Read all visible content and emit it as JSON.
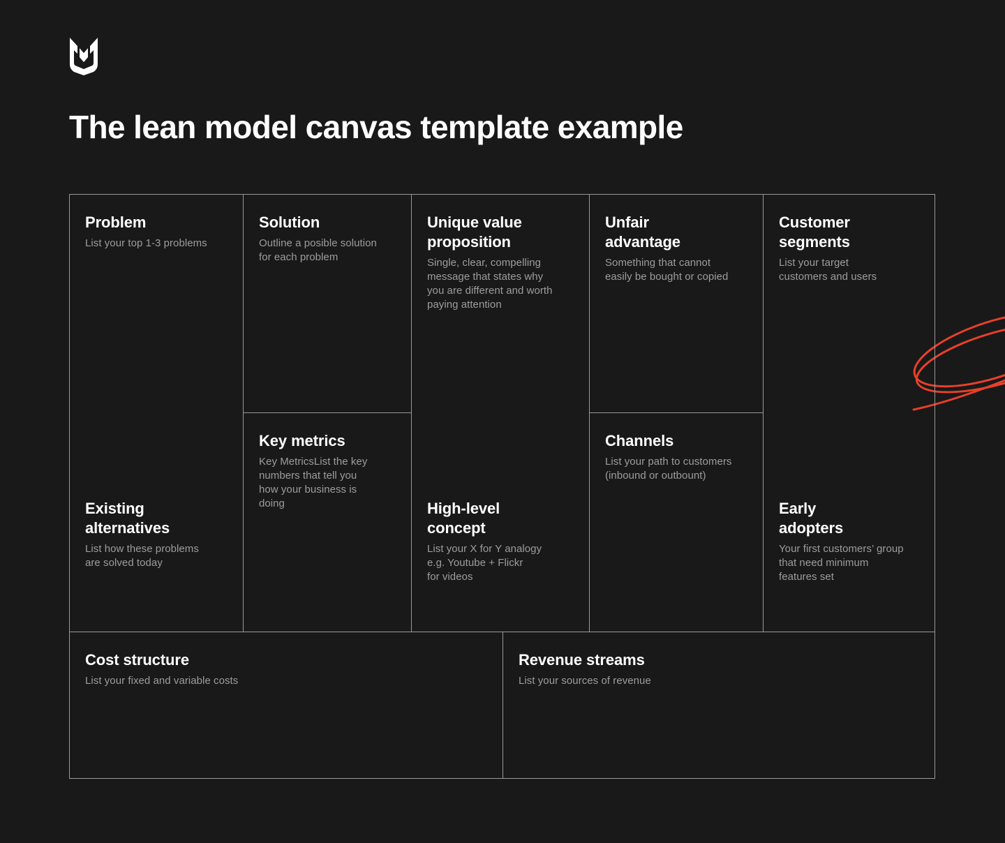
{
  "brand": {
    "logo_icon": "ms-monogram-shield-logo",
    "logo_color": "#ffffff"
  },
  "header": {
    "title": "The lean model canvas template example"
  },
  "theme": {
    "background": "#191919",
    "border": "#9a9a9a",
    "title_color": "#ffffff",
    "description_color": "#9d9d9d",
    "accent": "#e8402a"
  },
  "decoration": {
    "name": "red-scribble-ellipse",
    "color": "#e8402a"
  },
  "canvas": {
    "cells": [
      {
        "key": "problem",
        "title": "Problem",
        "description": "List your top 1-3 problems"
      },
      {
        "key": "existing_alternatives",
        "title": "Existing\nalternatives",
        "description": "List how these problems\nare solved today"
      },
      {
        "key": "solution",
        "title": "Solution",
        "description": "Outline a posible solution\nfor each problem"
      },
      {
        "key": "key_metrics",
        "title": "Key metrics",
        "description": "Key MetricsList the key\nnumbers that tell you\nhow your business is\ndoing"
      },
      {
        "key": "unique_value_proposition",
        "title": "Unique value\nproposition",
        "description": "Single, clear, compelling\nmessage that states why\nyou are different and worth\npaying attention"
      },
      {
        "key": "high_level_concept",
        "title": "High-level\nconcept",
        "description": "List your X for Y analogy\ne.g. Youtube + Flickr\nfor videos"
      },
      {
        "key": "unfair_advantage",
        "title": "Unfair\nadvantage",
        "description": "Something that cannot\neasily be bought or copied"
      },
      {
        "key": "channels",
        "title": "Channels",
        "description": "List your path to customers\n(inbound or outbount)"
      },
      {
        "key": "customer_segments",
        "title": "Customer\nsegments",
        "description": "List your target\ncustomers and users"
      },
      {
        "key": "early_adopters",
        "title": "Early\nadopters",
        "description": "Your first customers’ group\nthat need minimum\nfeatures set"
      },
      {
        "key": "cost_structure",
        "title": "Cost structure",
        "description": "List your fixed and variable costs"
      },
      {
        "key": "revenue_streams",
        "title": "Revenue streams",
        "description": "List your sources of revenue"
      }
    ]
  }
}
